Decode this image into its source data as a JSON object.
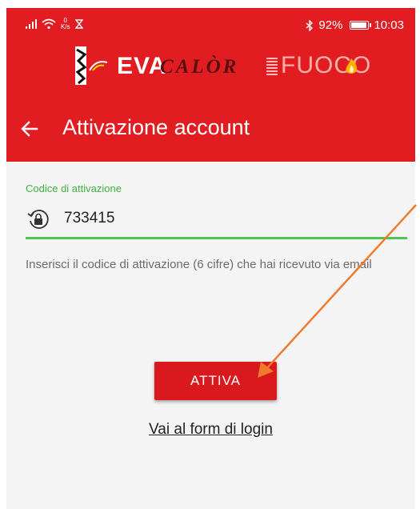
{
  "status_bar": {
    "network_speed_value": "0",
    "network_speed_unit": "K/s",
    "battery": "92%",
    "time": "10:03"
  },
  "brand": {
    "eva": "EVA",
    "calor": "CALÒR",
    "fuoco": "FUOCO"
  },
  "toolbar": {
    "title": "Attivazione account"
  },
  "form": {
    "label": "Codice di attivazione",
    "code_value": "733415",
    "helper": "Inserisci il codice di attivazione (6 cifre) che hai ricevuto via email"
  },
  "actions": {
    "activate_label": "ATTIVA",
    "login_link": "Vai al form di login"
  },
  "colors": {
    "appbar": "#e11d22",
    "accent_green": "#4cc84c",
    "button": "#d9191d",
    "annotation_arrow": "#f07a2e"
  },
  "icons": [
    "signal-icon",
    "wifi-icon",
    "hourglass-icon",
    "bluetooth-icon",
    "battery-icon",
    "back-arrow-icon",
    "lock-refresh-icon"
  ]
}
